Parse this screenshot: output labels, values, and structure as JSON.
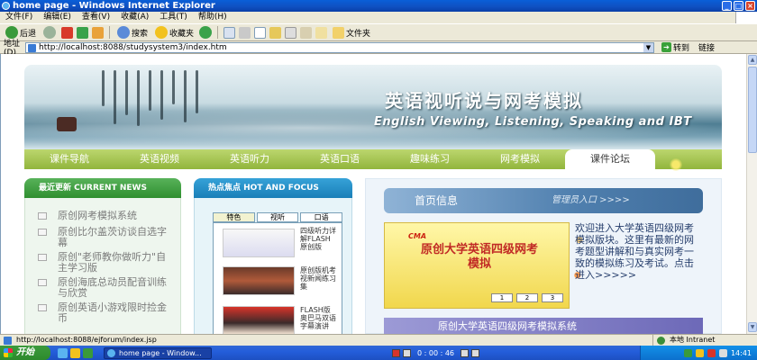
{
  "window": {
    "title": "home page - Windows Internet Explorer",
    "buttons": [
      "_",
      "□",
      "×"
    ]
  },
  "menu": [
    "文件(F)",
    "编辑(E)",
    "查看(V)",
    "收藏(A)",
    "工具(T)",
    "帮助(H)"
  ],
  "toolbar": {
    "back_label": "后退",
    "search_label": "搜索",
    "favorites_label": "收藏夹",
    "folders_label": "文件夹"
  },
  "address": {
    "label": "地址(D)",
    "url": "http://localhost:8088/studysystem3/index.htm",
    "go_label": "转到",
    "links_label": "链接"
  },
  "banner": {
    "title": "英语视听说与网考模拟",
    "subtitle": "English Viewing, Listening, Speaking and IBT"
  },
  "nav": [
    {
      "label": "课件导航"
    },
    {
      "label": "英语视频"
    },
    {
      "label": "英语听力"
    },
    {
      "label": "英语口语"
    },
    {
      "label": "趣味练习"
    },
    {
      "label": "网考模拟"
    },
    {
      "label": "课件论坛"
    }
  ],
  "latest": {
    "heading": "最近更新 CURRENT NEWS",
    "items": [
      "原创网考模拟系统",
      "原创比尔盖茨访谈自选字幕",
      "原创\"老师教你做听力\"自主学习版",
      "原创海底总动员配音训练与欣赏",
      "原创英语小游戏限时捡金币"
    ]
  },
  "focus": {
    "heading": "热点焦点 HOT AND FOCUS",
    "tabs": [
      "特色",
      "视听",
      "口语"
    ],
    "captions": [
      "四级听力详解FLASH原创版",
      "原创版机考视新闻练习集",
      "FLASH版奥巴马双语字幕演讲"
    ]
  },
  "home": {
    "title": "首页信息",
    "admin_link": "管理员入口 >>>>",
    "card_logo": "CMA",
    "card_title": "原创大学英语四级网考模拟",
    "card_pages": [
      "1",
      "2",
      "3"
    ],
    "welcome": "欢迎进入大学英语四级网考模拟版块。这里有最新的网考题型讲解和与真实网考一致的模拟练习及考试。点击进入>>>>>",
    "bottom_banner": "原创大学英语四级网考模拟系统"
  },
  "status": {
    "url": "http://localhost:8088/ejforum/index.jsp",
    "zone": "本地 Intranet"
  },
  "taskbar": {
    "start": "开始",
    "task": "home page - Window...",
    "media_time": "0 : 00 : 46",
    "clock": "14:41"
  }
}
